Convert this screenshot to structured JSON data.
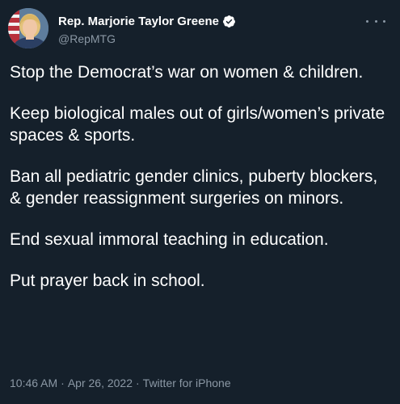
{
  "tweet": {
    "author": {
      "display_name": "Rep. Marjorie Taylor Greene",
      "handle": "@RepMTG",
      "verified": true,
      "avatar_icon": "profile-photo"
    },
    "more_icon": "more-horizontal-icon",
    "paragraphs": [
      "Stop the Democrat’s war on women & children.",
      "Keep biological males out of girls/women’s private spaces & sports.",
      "Ban all pediatric gender clinics, puberty blockers, & gender reassignment surgeries on minors.",
      "End sexual immoral teaching in education.",
      "Put prayer back in school."
    ],
    "meta": {
      "time": "10:46 AM",
      "separator": "·",
      "date": "Apr 26, 2022",
      "source": "Twitter for iPhone"
    }
  },
  "colors": {
    "background": "#15202b",
    "text_primary": "#ffffff",
    "text_secondary": "#8b98a5",
    "verified_badge": "#ffffff"
  }
}
